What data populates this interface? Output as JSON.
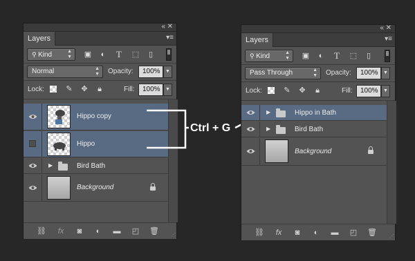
{
  "panel_left": {
    "tab_label": "Layers",
    "window_buttons": [
      "«",
      "✕"
    ],
    "filter_kind": "Kind",
    "blend_mode": "Normal",
    "opacity_label": "Opacity:",
    "opacity_value": "100%",
    "lock_label": "Lock:",
    "fill_label": "Fill:",
    "fill_value": "100%",
    "layers": [
      {
        "name": "Hippo copy",
        "visible": true,
        "selected": true,
        "type": "pixel"
      },
      {
        "name": "Hippo",
        "visible": false,
        "selected": true,
        "type": "pixel"
      },
      {
        "name": "Bird Bath",
        "visible": true,
        "selected": false,
        "type": "group"
      },
      {
        "name": "Background",
        "visible": true,
        "selected": false,
        "type": "background",
        "locked": true
      }
    ],
    "footer_icons": [
      "link-icon",
      "fx-icon",
      "mask-icon",
      "adjustment-icon",
      "group-icon",
      "new-layer-icon",
      "trash-icon"
    ]
  },
  "panel_right": {
    "tab_label": "Layers",
    "window_buttons": [
      "«",
      "✕"
    ],
    "filter_kind": "Kind",
    "blend_mode": "Pass Through",
    "opacity_label": "Opacity:",
    "opacity_value": "100%",
    "lock_label": "Lock:",
    "fill_label": "Fill:",
    "fill_value": "100%",
    "layers": [
      {
        "name": "Hippo in Bath",
        "visible": true,
        "selected": true,
        "type": "group"
      },
      {
        "name": "Bird Bath",
        "visible": true,
        "selected": false,
        "type": "group"
      },
      {
        "name": "Background",
        "visible": true,
        "selected": false,
        "type": "background",
        "locked": true
      }
    ],
    "footer_icons": [
      "link-icon",
      "fx-icon",
      "mask-icon",
      "adjustment-icon",
      "group-icon",
      "new-layer-icon",
      "trash-icon"
    ]
  },
  "annotation": {
    "shortcut": "Ctrl + G"
  },
  "colors": {
    "background": "#272727",
    "panel": "#535353",
    "selection": "#596b82"
  }
}
